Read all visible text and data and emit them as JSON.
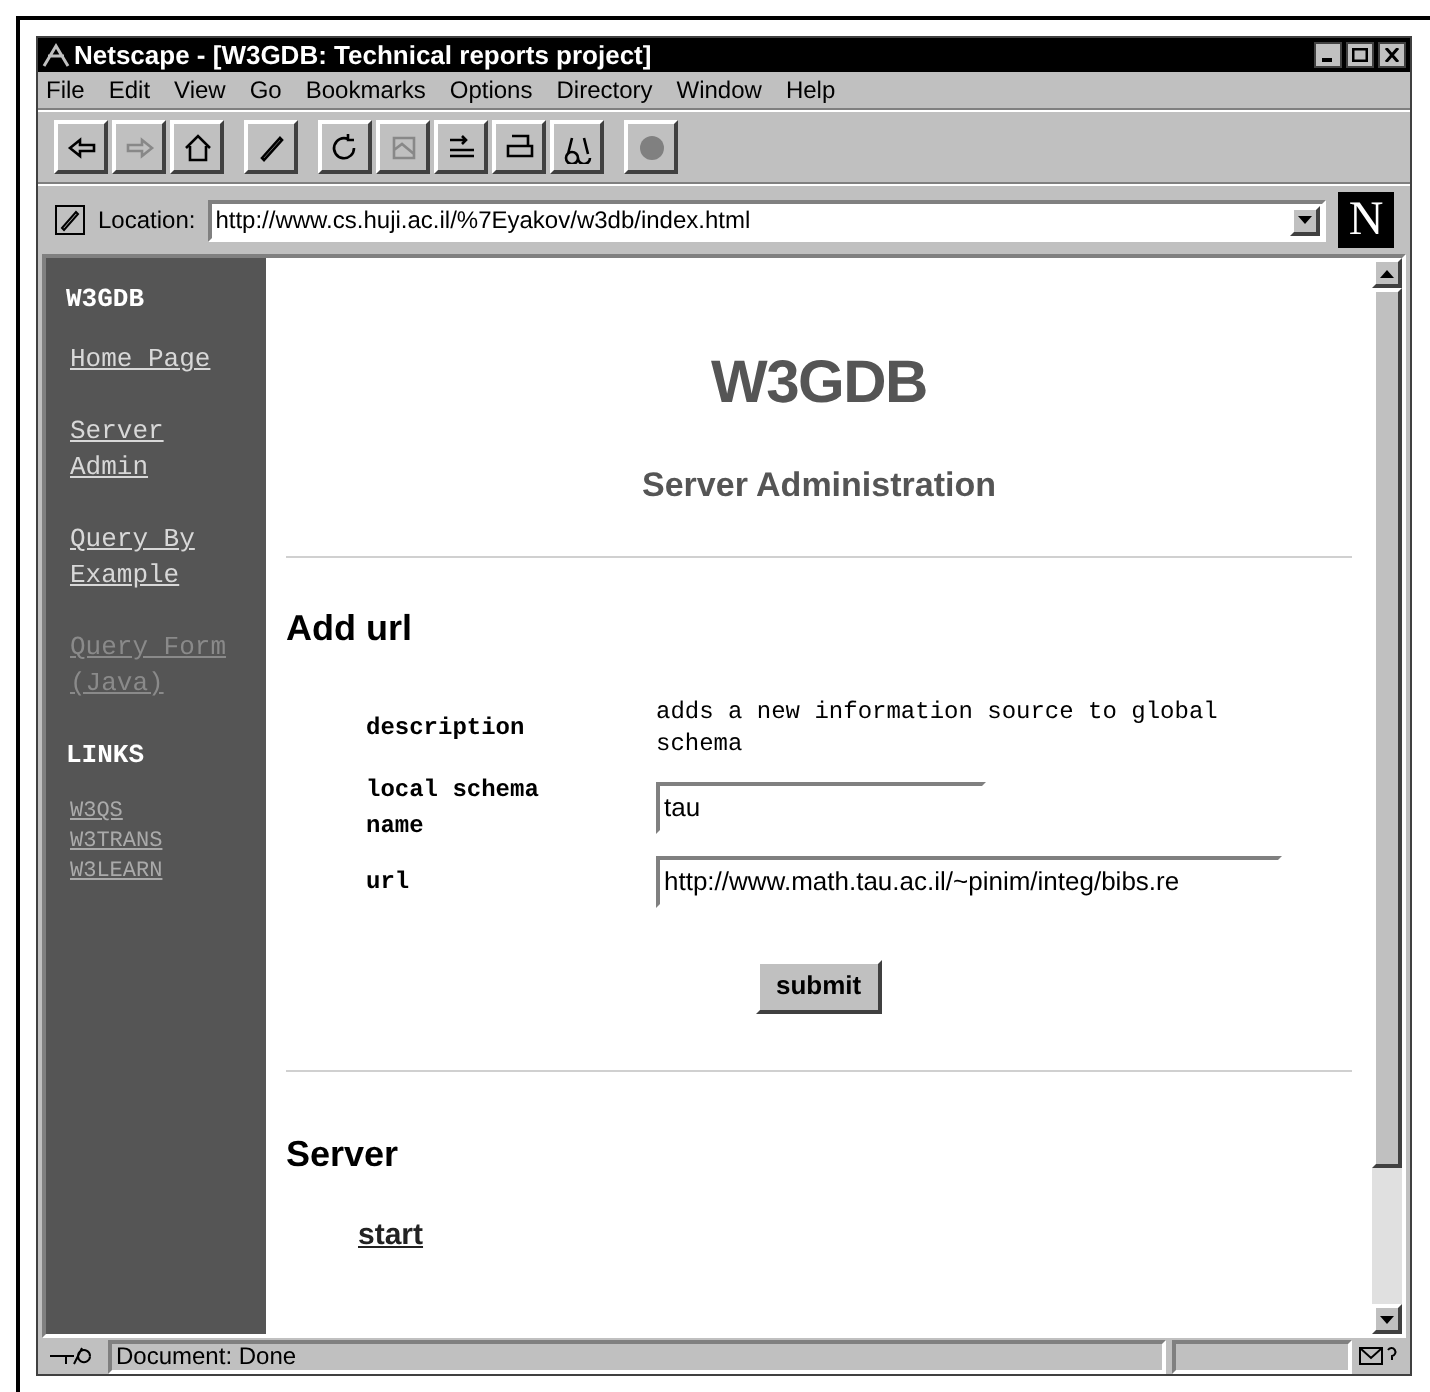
{
  "window": {
    "title": "Netscape - [W3GDB: Technical reports project]"
  },
  "menu": [
    "File",
    "Edit",
    "View",
    "Go",
    "Bookmarks",
    "Options",
    "Directory",
    "Window",
    "Help"
  ],
  "location": {
    "label": "Location:",
    "value": "http://www.cs.huji.ac.il/%7Eyakov/w3db/index.html"
  },
  "logo": "N",
  "sidebar": {
    "title": "W3GDB",
    "items": [
      {
        "label": "Home Page",
        "visited": false
      },
      {
        "label": "Server Admin",
        "visited": false
      },
      {
        "label": "Query By Example",
        "visited": false
      },
      {
        "label": "Query Form (Java)",
        "visited": true
      }
    ],
    "links_title": "LINKS",
    "links": [
      "W3QS",
      "W3TRANS",
      "W3LEARN"
    ]
  },
  "page": {
    "title": "W3GDB",
    "subtitle": "Server Administration",
    "section": "Add url",
    "form": [
      {
        "kind": "text",
        "label": "description",
        "value": "adds a new information source to global schema"
      },
      {
        "kind": "input",
        "label": "local schema name",
        "value": "tau"
      },
      {
        "kind": "input",
        "label": "url",
        "value": "http://www.math.tau.ac.il/~pinim/integ/bibs.re"
      }
    ],
    "submit": "submit",
    "section2": "Server",
    "link": "start"
  },
  "status_bar": {
    "text": "Document: Done"
  }
}
